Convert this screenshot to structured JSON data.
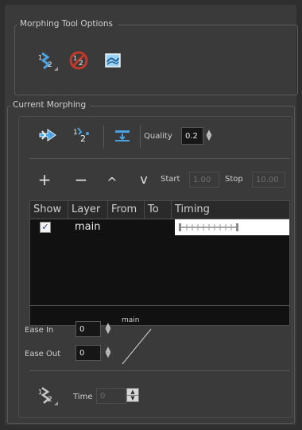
{
  "options_group": {
    "title": "Morphing Tool Options",
    "icons": [
      "morph-order-icon",
      "morph-no-order-icon",
      "morph-layer-icon"
    ]
  },
  "current_group": {
    "title": "Current Morphing",
    "toolbar": {
      "icons": [
        "morph-go-icon",
        "morph-hint-icon",
        "morph-convert-icon"
      ],
      "quality_label": "Quality",
      "quality_value": "0.2"
    },
    "nav": {
      "add": "+",
      "remove": "−",
      "up": "^",
      "down": "v",
      "start_label": "Start",
      "start_value": "1.00",
      "stop_label": "Stop",
      "stop_value": "10.00"
    },
    "table": {
      "headers": [
        "Show",
        "Layer",
        "From",
        "To",
        "Timing"
      ],
      "rows": [
        {
          "show": "✓",
          "layer": "main",
          "from": "",
          "to": ""
        }
      ]
    },
    "ease": {
      "ease_in_label": "Ease In",
      "ease_in_value": "0",
      "ease_out_label": "Ease Out",
      "ease_out_value": "0",
      "curve_label": "main"
    },
    "bottom": {
      "time_label": "Time",
      "time_value": "0"
    }
  },
  "colors": {
    "panel": "#3a3a3a",
    "icon_blue": "#4aa3e0",
    "icon_red": "#c0392b"
  }
}
